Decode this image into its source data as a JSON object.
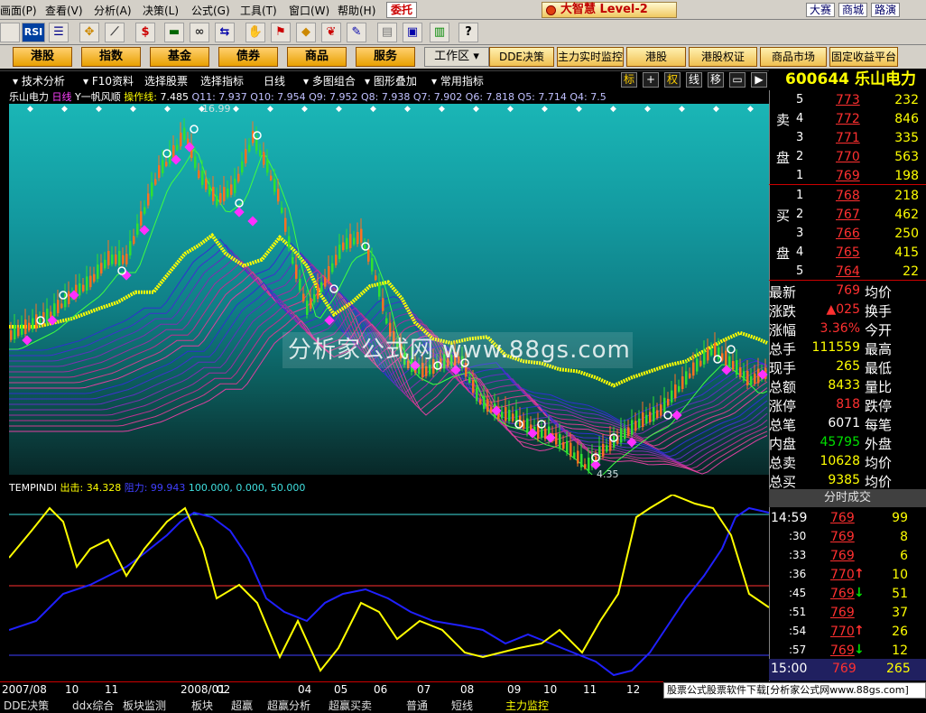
{
  "menu": [
    "画面(P)",
    "查看(V)",
    "分析(A)",
    "决策(L)",
    "公式(G)",
    "工具(T)",
    "窗口(W)",
    "帮助(H)"
  ],
  "weituo": "委托",
  "brand": "大智慧 Level-2",
  "top_right": [
    "大赛",
    "商城",
    "路演"
  ],
  "toolbar_icons": [
    "RSI"
  ],
  "nav": [
    "港股",
    "指数",
    "基金",
    "债券",
    "商品",
    "服务"
  ],
  "workarea": "工作区",
  "nav2": [
    "DDE决策",
    "主力实时监控",
    "港股",
    "港股权证",
    "商品市场",
    "固定收益平台"
  ],
  "subtoolbar": [
    "技术分析",
    "F10资料",
    "选择股票",
    "选择指标",
    "日线",
    "多图组合",
    "图形叠加",
    "常用指标"
  ],
  "subtoolbar_right": [
    "标",
    "权",
    "线",
    "移"
  ],
  "stock": {
    "code": "600644",
    "name": "乐山电力"
  },
  "chart_info": {
    "stock": "乐山电力",
    "period": "日线",
    "formula": "Y一帆风顺",
    "op_label": "操作线:",
    "op_value": "7.485",
    "items": "Q11: 7.937  Q10: 7.954  Q9: 7.952  Q8: 7.938  Q7: 7.902  Q6: 7.818  Q5: 7.714  Q4: 7.5"
  },
  "price_labels": {
    "high": "16.99",
    "low": "4.35"
  },
  "watermark": "分析家公式网 www.88gs.com",
  "indicator": {
    "name": "TEMPINDI",
    "out_label": "出击:",
    "out_value": "34.328",
    "res_label": "阻力:",
    "res_value": "99.943",
    "lines": "100.000, 0.000, 50.000"
  },
  "asks": [
    {
      "level": "5",
      "price": "773",
      "vol": "232"
    },
    {
      "level": "4",
      "price": "772",
      "vol": "846"
    },
    {
      "level": "3",
      "price": "771",
      "vol": "335"
    },
    {
      "level": "2",
      "price": "770",
      "vol": "563"
    },
    {
      "level": "1",
      "price": "769",
      "vol": "198"
    }
  ],
  "bids": [
    {
      "level": "1",
      "price": "768",
      "vol": "218"
    },
    {
      "level": "2",
      "price": "767",
      "vol": "462"
    },
    {
      "level": "3",
      "price": "766",
      "vol": "250"
    },
    {
      "level": "4",
      "price": "765",
      "vol": "415"
    },
    {
      "level": "5",
      "price": "764",
      "vol": "22"
    }
  ],
  "sell_label": [
    "卖",
    "盘"
  ],
  "buy_label": [
    "买",
    "盘"
  ],
  "stats": [
    {
      "l": "最新",
      "v": "769",
      "r": "均价"
    },
    {
      "l": "涨跌",
      "v": "▲025",
      "r": "换手"
    },
    {
      "l": "涨幅",
      "v": "3.36%",
      "r": "今开"
    },
    {
      "l": "总手",
      "v": "111559",
      "r": "最高"
    },
    {
      "l": "现手",
      "v": "265",
      "r": "最低"
    },
    {
      "l": "总额",
      "v": "8433",
      "r": "量比"
    },
    {
      "l": "涨停",
      "v": "818",
      "r": "跌停"
    },
    {
      "l": "总笔",
      "v": "6071",
      "r": "每笔"
    },
    {
      "l": "内盘",
      "v": "45795",
      "r": "外盘"
    },
    {
      "l": "总卖",
      "v": "10628",
      "r": "均价"
    },
    {
      "l": "总买",
      "v": "9385",
      "r": "均价"
    }
  ],
  "ticks_header": "分时成交",
  "ticks": [
    {
      "t": "14:59",
      "p": "769",
      "a": "",
      "v": "99"
    },
    {
      "t": ":30",
      "p": "769",
      "a": "",
      "v": "8"
    },
    {
      "t": ":33",
      "p": "769",
      "a": "",
      "v": "6"
    },
    {
      "t": ":36",
      "p": "770",
      "a": "↑",
      "v": "10"
    },
    {
      "t": ":45",
      "p": "769",
      "a": "↓",
      "v": "51"
    },
    {
      "t": ":51",
      "p": "769",
      "a": "",
      "v": "37"
    },
    {
      "t": ":54",
      "p": "770",
      "a": "↑",
      "v": "26"
    },
    {
      "t": ":57",
      "p": "769",
      "a": "↓",
      "v": "12"
    }
  ],
  "tick_last": {
    "t": "15:00",
    "p": "769",
    "v": "265"
  },
  "time_axis": [
    "2007/08",
    "10",
    "11",
    "2008/01",
    "02",
    "04",
    "05",
    "06",
    "07",
    "08",
    "09",
    "10",
    "11",
    "12"
  ],
  "bottom_tabs": [
    "DDE决策",
    "ddx综合",
    "板块监测",
    "板块",
    "超赢",
    "超赢分析",
    "超赢买卖",
    "普通",
    "短线",
    "主力监控"
  ],
  "footer": "股票公式股票软件下载[分析家公式网www.88gs.com]"
}
